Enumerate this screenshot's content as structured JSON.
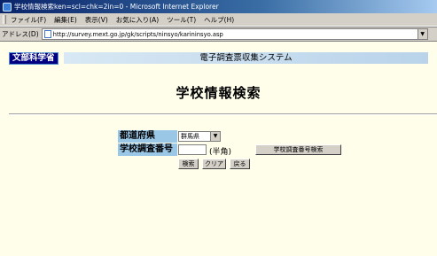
{
  "window": {
    "title": "学校情報検索ken=scl=chk=2in=0 - Microsoft Internet Explorer"
  },
  "menu": [
    "ファイル(F)",
    "編集(E)",
    "表示(V)",
    "お気に入り(A)",
    "ツール(T)",
    "ヘルプ(H)"
  ],
  "address": {
    "label": "アドレス(D)",
    "url": "http://survey.mext.go.jp/gk/scripts/ninsyo/karininsyo.asp"
  },
  "header": {
    "ministry": "文部科学省",
    "system_name": "電子調査票収集システム"
  },
  "page": {
    "title": "学校情報検索"
  },
  "form": {
    "prefecture_label": "都道府県",
    "prefecture_value": "群馬県",
    "school_code_label": "学校調査番号",
    "school_code_value": "",
    "halfwidth_hint": "(半角)",
    "code_search_button": "学校調査番号検索",
    "search_button": "検索",
    "clear_button": "クリア",
    "back_button": "戻る"
  }
}
